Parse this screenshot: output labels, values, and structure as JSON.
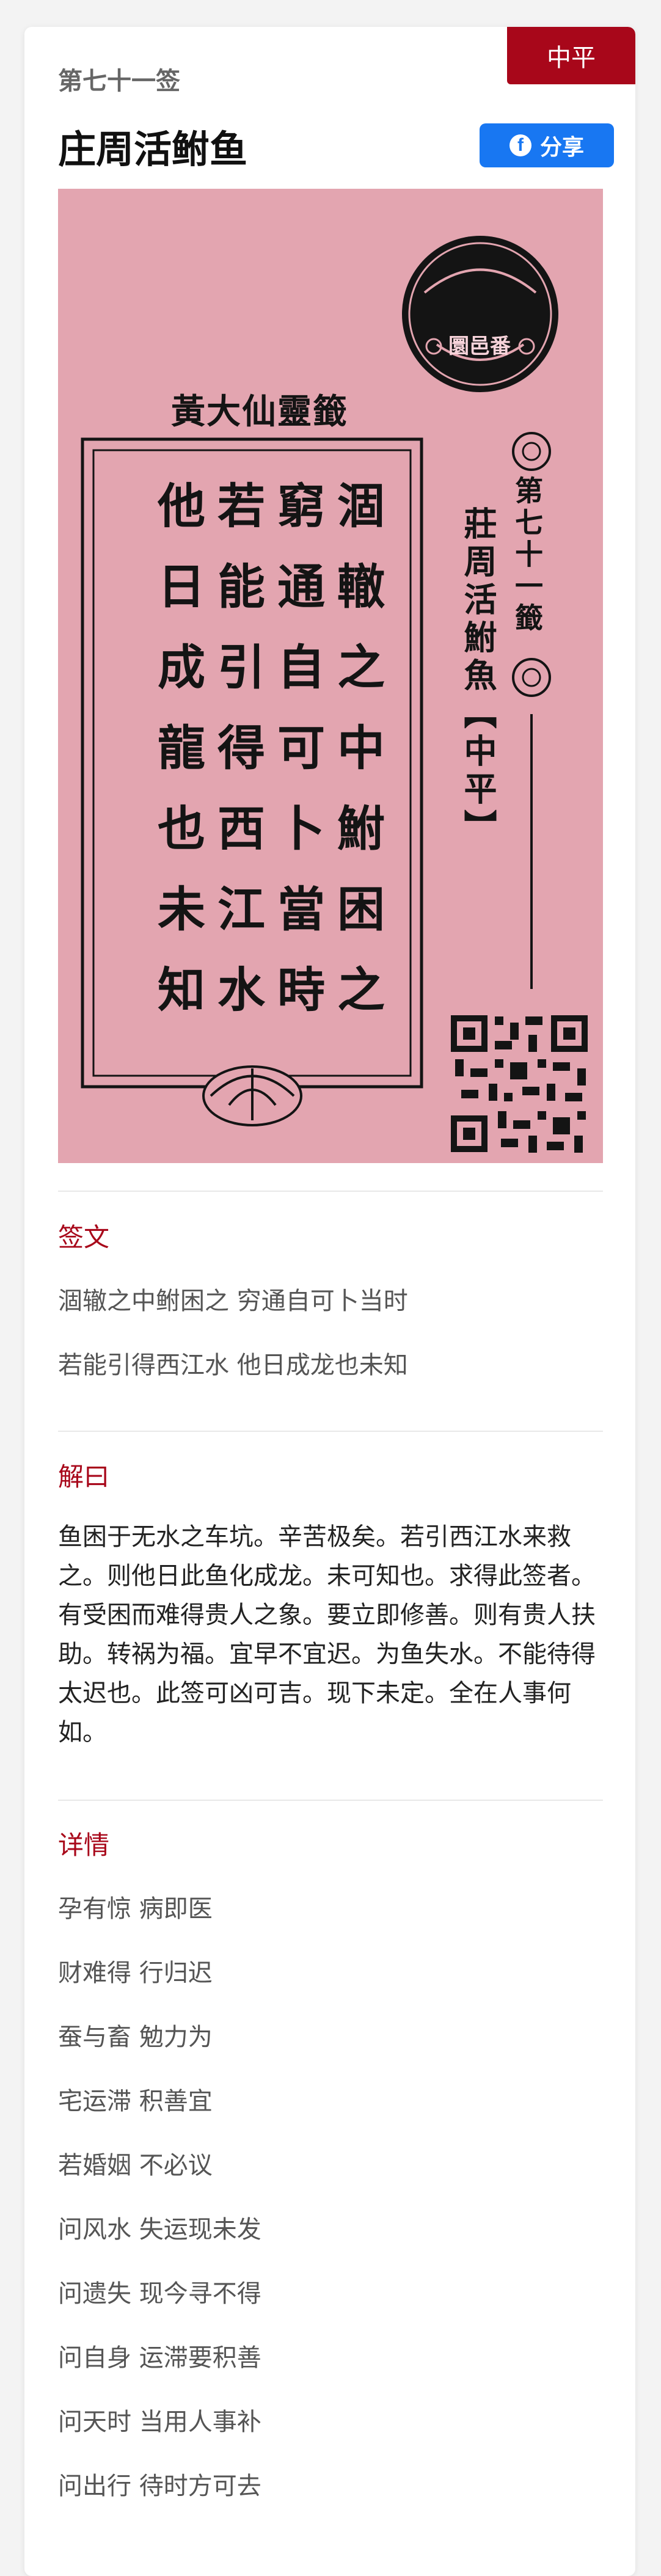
{
  "header": {
    "number": "第七十一签",
    "title": "庄周活鲋鱼",
    "grade": "中平",
    "share_label": "分享"
  },
  "stick_image": {
    "seal_text": "圜邑番",
    "title": "黃大仙靈籤",
    "number": "第七十一籤",
    "name": "莊周活鮒魚【中平】",
    "poem_lines": [
      "涸轍之中鮒困之",
      "窮通自可卜當時",
      "若能引得西江水",
      "他日成龍也未知"
    ],
    "colors": {
      "background": "#e3a5b0",
      "ink": "#141414"
    }
  },
  "poem": {
    "label": "签文",
    "lines": [
      "涸辙之中鲋困之 穷通自可卜当时",
      "若能引得西江水 他日成龙也未知"
    ]
  },
  "interpretation": {
    "label": "解曰",
    "text": "鱼困于无水之车坑。辛苦极矣。若引西江水来救之。则他日此鱼化成龙。未可知也。求得此签者。有受困而难得贵人之象。要立即修善。则有贵人扶助。转祸为福。宜早不宜迟。为鱼失水。不能待得太迟也。此签可凶可吉。现下未定。全在人事何如。"
  },
  "details": {
    "label": "详情",
    "items": [
      "孕有惊 病即医",
      "财难得 行归迟",
      "蚕与畜 勉力为",
      "宅运滞 积善宜",
      "若婚姻 不必议",
      "问风水 失运现未发",
      "问遗失 现今寻不得",
      "问自身 运滞要积善",
      "问天时 当用人事补",
      "问出行 待时方可去"
    ]
  },
  "colors": {
    "accent": "#a8071a",
    "facebook": "#1877f2"
  },
  "icons": {
    "share": "facebook-icon"
  }
}
